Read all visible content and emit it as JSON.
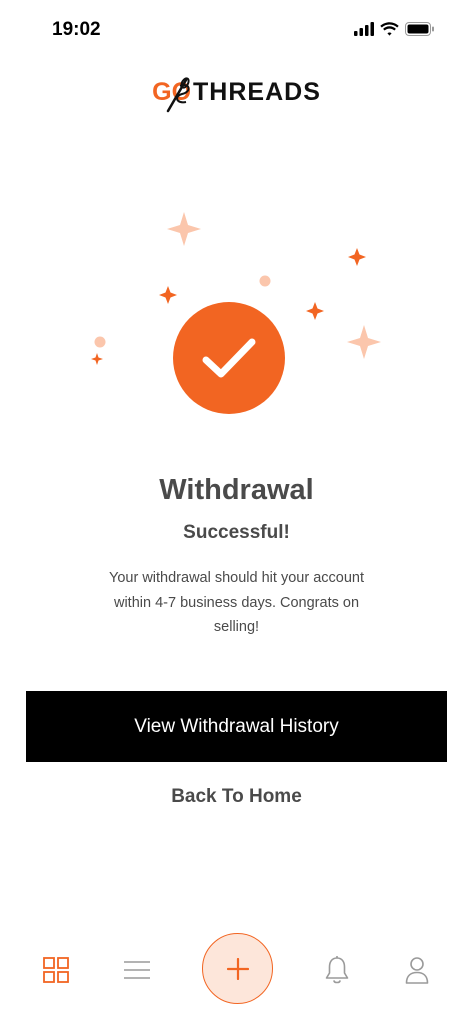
{
  "status_bar": {
    "time": "19:02",
    "icons": [
      "signal-icon",
      "wifi-icon",
      "battery-icon"
    ]
  },
  "logo": {
    "part1": "GO",
    "part2": "THREADS"
  },
  "success": {
    "title": "Withdrawal",
    "subtitle": "Successful!",
    "message": "Your withdrawal should hit your account within 4-7 business days.  Congrats on selling!"
  },
  "actions": {
    "primary_label": "View Withdrawal History",
    "secondary_label": "Back To Home"
  },
  "tab_bar": {
    "items": [
      "grid-icon",
      "menu-icon",
      "plus-icon",
      "bell-icon",
      "profile-icon"
    ],
    "active": "grid-icon"
  },
  "colors": {
    "accent": "#f26522",
    "accent_light": "#fbc6ac",
    "text": "#4a4a4a",
    "button_bg": "#000000"
  }
}
